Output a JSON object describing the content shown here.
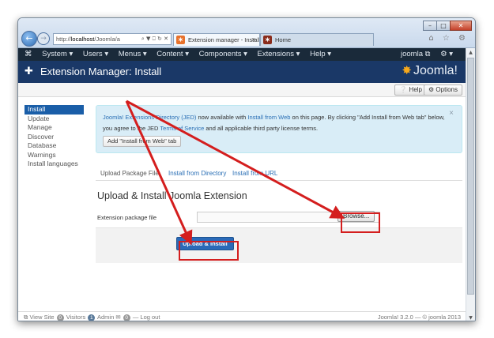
{
  "browser": {
    "address": {
      "prefix": "http://",
      "host": "localhost",
      "path": "/Joomla/a",
      "tools": "⌕ ▼ ⎕ ↻ ✕"
    },
    "tabs": [
      {
        "label": "Extension manager - Install",
        "close": "✕",
        "icon_color": "#e8722c"
      },
      {
        "label": "Home",
        "icon_color": "#8a2c1c"
      }
    ],
    "caption": {
      "minimize": "–",
      "maximize": "□",
      "close": "✕"
    },
    "toolbar_icons": "⌂ ☆ ⚙"
  },
  "topnav": {
    "items": [
      "System ▾",
      "Users ▾",
      "Menus ▾",
      "Content ▾",
      "Components ▾",
      "Extensions ▾",
      "Help ▾"
    ],
    "joomla_icon": "⌘",
    "right_user": "joomla ⧉",
    "right_settings": "⚙ ▾"
  },
  "header": {
    "title": "Extension Manager: Install",
    "logo_text": "Joomla!",
    "logo_mark": "✸",
    "title_icon": "✚"
  },
  "toolbar": {
    "help": "❔ Help",
    "options": "⚙ Options"
  },
  "sidebar": {
    "items": [
      "Install",
      "Update",
      "Manage",
      "Discover",
      "Database",
      "Warnings",
      "Install languages"
    ]
  },
  "alert": {
    "part1": "Joomla! Extensions Directory (JED)",
    "part2": " now available with ",
    "part3": "Install from Web",
    "part4": " on this page.  By clicking \"Add Install from Web tab\" below, you agree to the JED ",
    "part5": "Terms of Service",
    "part6": " and all applicable third party license terms.",
    "button": "Add \"Install from Web\" tab",
    "close": "×"
  },
  "tabs": [
    "Upload Package File",
    "Install from Directory",
    "Install from URL"
  ],
  "form": {
    "title": "Upload & Install Joomla Extension",
    "label": "Extension package file",
    "browse": "Browse...",
    "submit": "Upload & Install"
  },
  "footer": {
    "view_site": "⧉ View Site",
    "visitors_count": "0",
    "visitors": "Visitors",
    "admin_count": "1",
    "admin": "Admin",
    "msg_count": "0",
    "logout": "— Log out",
    "version": "Joomla! 3.2.0 — © joomla 2013"
  },
  "colors": {
    "highlight": "#d41e1e",
    "brand": "#1a3867",
    "primary_button": "#2a6ab8"
  }
}
